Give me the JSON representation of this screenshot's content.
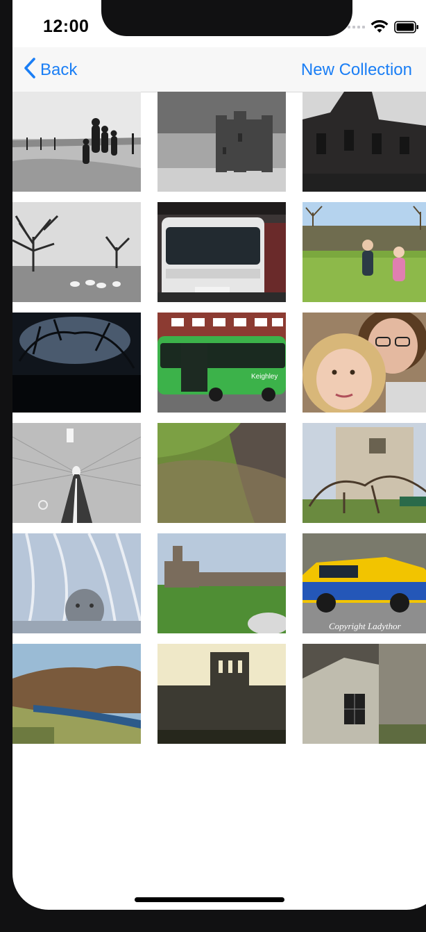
{
  "status_bar": {
    "time": "12:00",
    "icons": [
      "cellular-signal-icon",
      "wifi-icon",
      "battery-icon"
    ]
  },
  "nav": {
    "back_label": "Back",
    "back_icon": "chevron-left-icon",
    "action_label": "New Collection",
    "tint_color": "#1a7ef5"
  },
  "photos": [
    {
      "name": "bw-family-walking-beach"
    },
    {
      "name": "bw-ruined-tower-field"
    },
    {
      "name": "dark-ruined-abbey"
    },
    {
      "name": "bw-bare-trees-sheep"
    },
    {
      "name": "white-coach-bus-garage"
    },
    {
      "name": "kids-in-field-wall"
    },
    {
      "name": "dark-tree-tunnel"
    },
    {
      "name": "green-keighley-bus"
    },
    {
      "name": "mother-daughter-selfie"
    },
    {
      "name": "bw-tiled-tunnel-cycle-path"
    },
    {
      "name": "grassy-rock-outcrop"
    },
    {
      "name": "stone-church-tower"
    },
    {
      "name": "face-behind-net-curtain"
    },
    {
      "name": "castle-ruins-on-hill"
    },
    {
      "name": "rally-car"
    },
    {
      "name": "river-valley-autumn"
    },
    {
      "name": "abbey-silhouette-dusk"
    },
    {
      "name": "old-stone-building-window"
    }
  ],
  "photo_captions": {
    "rally_watermark": "Copyright Ladythor"
  }
}
